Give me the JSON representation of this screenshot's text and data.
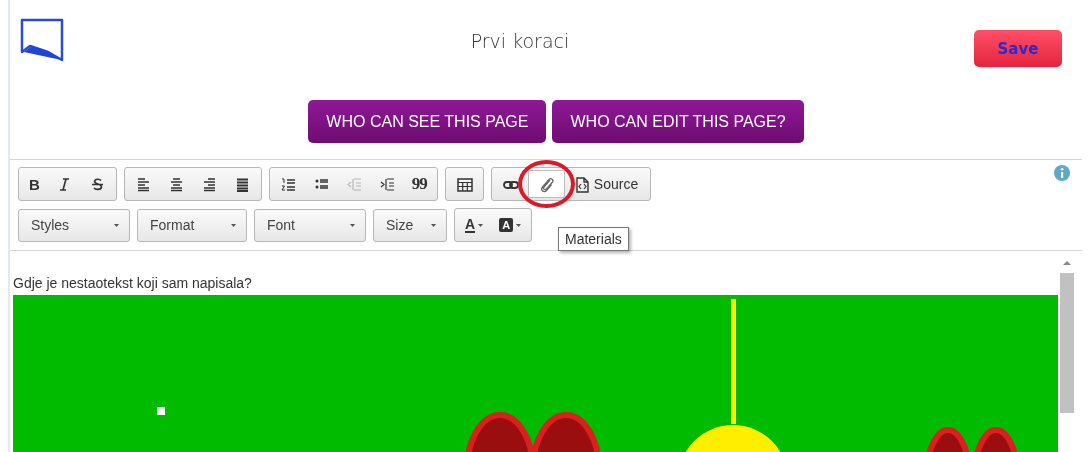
{
  "page": {
    "title": "Prvi koraci"
  },
  "save_button": {
    "label": "Save"
  },
  "access_buttons": [
    {
      "label": "WHO CAN SEE THIS PAGE"
    },
    {
      "label": "WHO CAN EDIT THIS PAGE?"
    }
  ],
  "toolbar": {
    "groups": [
      [
        {
          "kind": "bold",
          "disabled": false,
          "glyph": "B"
        },
        {
          "kind": "italic",
          "disabled": false
        },
        {
          "kind": "strike",
          "disabled": false
        }
      ],
      [
        {
          "kind": "alignleft",
          "disabled": false
        },
        {
          "kind": "aligncenter",
          "disabled": false
        },
        {
          "kind": "alignright",
          "disabled": false
        },
        {
          "kind": "justify",
          "disabled": false
        }
      ],
      [
        {
          "kind": "numbered",
          "disabled": false
        },
        {
          "kind": "bulleted",
          "disabled": false
        },
        {
          "kind": "outdent",
          "disabled": true
        },
        {
          "kind": "indent",
          "disabled": false
        },
        {
          "kind": "quote",
          "disabled": false,
          "glyph": "99"
        }
      ],
      [
        {
          "kind": "table",
          "disabled": false
        }
      ],
      [
        {
          "kind": "link",
          "disabled": false
        },
        {
          "kind": "attach",
          "disabled": false,
          "highlighted": true
        },
        {
          "kind": "source",
          "disabled": false,
          "label": "Source"
        }
      ]
    ],
    "dropdowns": [
      {
        "label": "Styles"
      },
      {
        "label": "Format"
      },
      {
        "label": "Font"
      },
      {
        "label": "Size"
      }
    ],
    "color_buttons": [
      {
        "kind": "textcolor",
        "glyph": "A"
      },
      {
        "kind": "bgcolor",
        "glyph": "A"
      }
    ]
  },
  "tooltip": {
    "text": "Materials"
  },
  "content": {
    "text": "Gdje je nestaotekst koji sam napisala?"
  }
}
